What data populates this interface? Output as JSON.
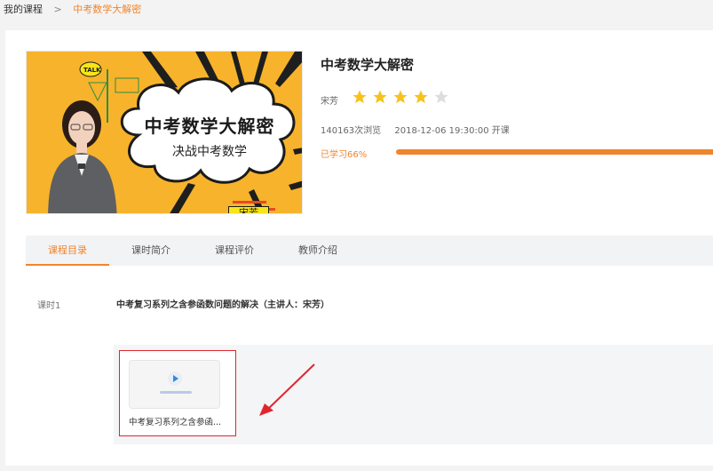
{
  "breadcrumb": {
    "root": "我的课程",
    "separator": ">",
    "current": "中考数学大解密"
  },
  "cover": {
    "cloud_title": "中考数学大解密",
    "cloud_subtitle": "决战中考数学",
    "talk_tag": "TALK",
    "name_tag": "宋芳"
  },
  "course": {
    "title": "中考数学大解密",
    "teacher": "宋芳",
    "rating": 4,
    "rating_max": 5,
    "views": "140163次浏览",
    "start": "2018-12-06 19:30:00 开课",
    "progress_label": "已学习66%",
    "progress": 0.66
  },
  "tabs": [
    {
      "label": "课程目录",
      "active": true
    },
    {
      "label": "课时简介",
      "active": false
    },
    {
      "label": "课程评价",
      "active": false
    },
    {
      "label": "教师介绍",
      "active": false
    }
  ],
  "lesson": {
    "label": "课时1",
    "title": "中考复习系列之含参函数问题的解决（主讲人：宋芳）",
    "resource_label": "中考复习系列之含参函..."
  },
  "colors": {
    "accent": "#f0852d",
    "highlight_border": "#e0262d",
    "star_active": "#f6c21c",
    "star_inactive": "#dddddd"
  }
}
